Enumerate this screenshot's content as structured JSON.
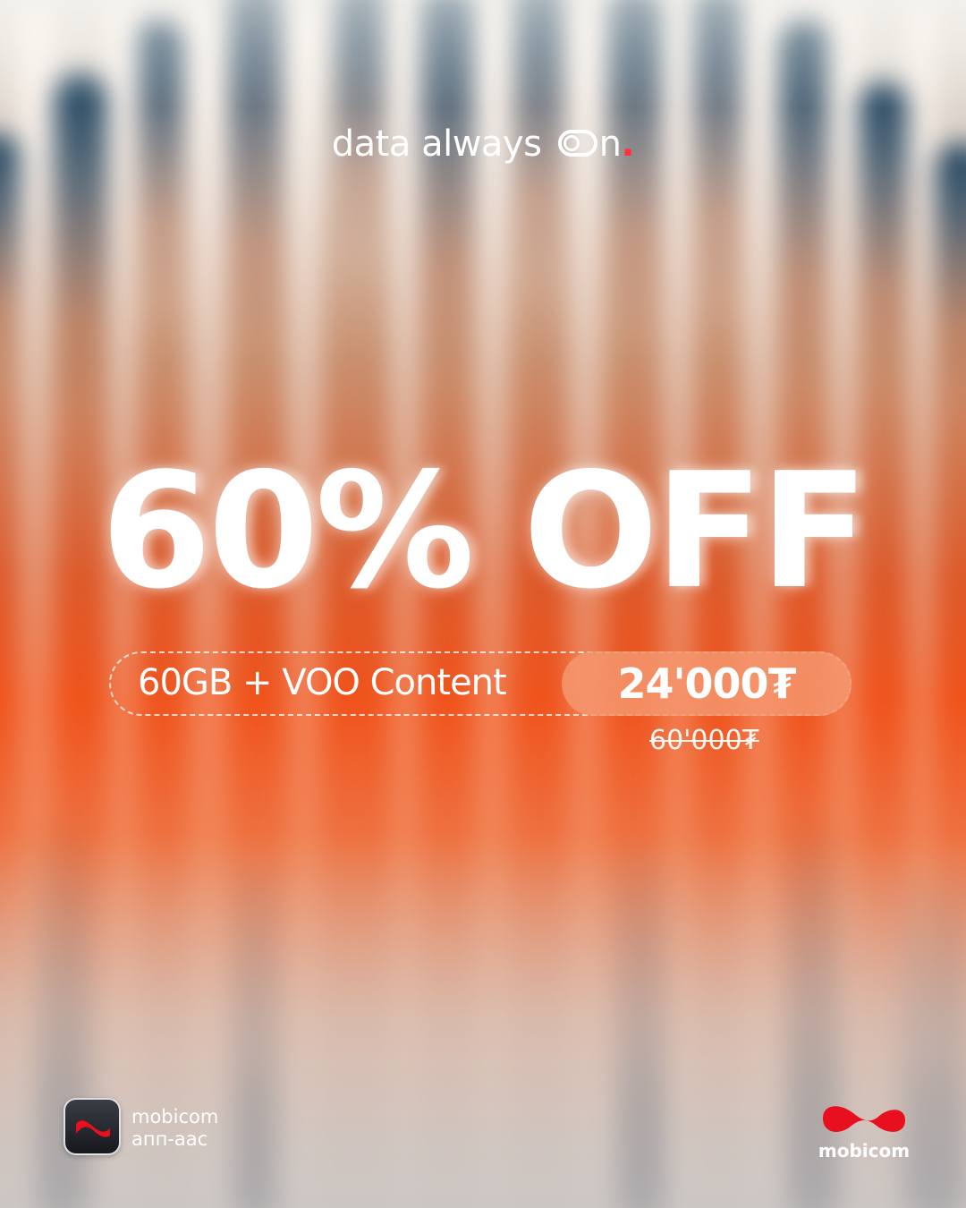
{
  "tagline": {
    "part1": "data always ",
    "part2": "n",
    "dot": "."
  },
  "headline": "60% OFF",
  "offer": {
    "description": "60GB  + VOO Content",
    "price": "24'000₮",
    "old_price": "60'000₮"
  },
  "app": {
    "line1": "mobicom",
    "line2": "апп-аас"
  },
  "brand": {
    "name": "mobicom"
  },
  "colors": {
    "accent": "#f0531c",
    "logo_red": "#e8101e"
  },
  "icons": {
    "toggle": "toggle-icon",
    "app": "mobicom-app-icon",
    "logo": "mobicom-logo-icon"
  }
}
